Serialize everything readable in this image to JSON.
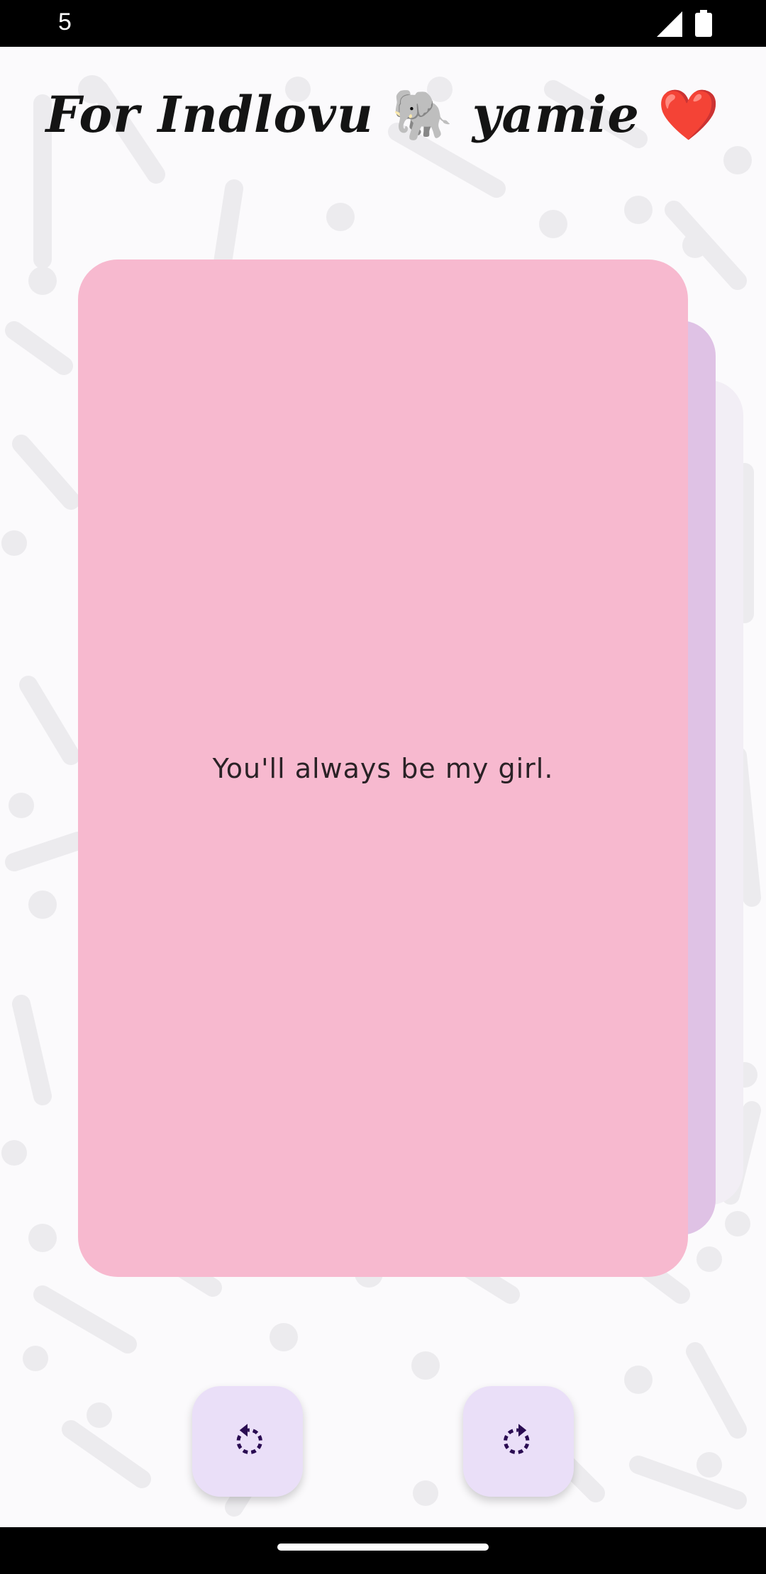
{
  "status_bar": {
    "time": "5",
    "signal_icon": "signal-icon",
    "battery_icon": "battery-icon"
  },
  "header": {
    "title_part1": "For Indlovu",
    "title_emoji1": "🐘",
    "title_part2": "yamie",
    "title_emoji2": "❤️"
  },
  "card": {
    "message": "You'll always be my girl.",
    "front_color": "#f7b9cf",
    "back_color": "#dfc2e5"
  },
  "controls": {
    "undo_icon": "rotate-left-icon",
    "redo_icon": "rotate-right-icon",
    "button_color": "#eadff8",
    "icon_color": "#2a0b52"
  }
}
